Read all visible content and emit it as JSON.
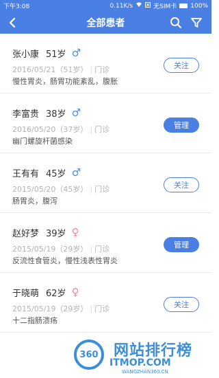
{
  "status_bar": {
    "time": "下午3:08",
    "network_speed": "0.11K/s",
    "carrier": "无SIM卡",
    "battery": "100%"
  },
  "header": {
    "title": "全部患者",
    "back_icon": "chevron-left-icon",
    "search_icon": "search-icon",
    "filter_icon": "filter-icon"
  },
  "colors": {
    "primary": "#4a7fe4",
    "male": "#4a90e2",
    "female": "#f08aa0"
  },
  "patients": [
    {
      "name": "张小康",
      "age": "51岁",
      "gender": "male",
      "gender_symbol": "♂",
      "date": "2016/05/21",
      "age_paren": "（51岁）",
      "type": "门诊",
      "diagnosis": "慢性胃炎，肠胃功能紊乱，腹胀",
      "action": "关注"
    },
    {
      "name": "李富贵",
      "age": "38岁",
      "gender": "male",
      "gender_symbol": "♂",
      "date": "2016/05/20",
      "age_paren": "（37岁）",
      "type": "门诊",
      "diagnosis": "幽门螺旋杆菌感染",
      "action": "管理"
    },
    {
      "name": "王有有",
      "age": "45岁",
      "gender": "male",
      "gender_symbol": "♂",
      "date": "2015/05/20",
      "age_paren": "（45岁）",
      "type": "门诊",
      "diagnosis": "肠胃炎，腹泻",
      "action": "关注"
    },
    {
      "name": "赵好梦",
      "age": "39岁",
      "gender": "female",
      "gender_symbol": "♀",
      "date": "2015/05/19",
      "age_paren": "（29岁）",
      "type": "门诊",
      "diagnosis": "反流性食管炎，慢性浅表性胃炎",
      "action": "管理"
    },
    {
      "name": "于晓萌",
      "age": "62岁",
      "gender": "female",
      "gender_symbol": "♀",
      "date": "2015/05/19",
      "age_paren": "（29岁）",
      "type": "门诊",
      "diagnosis": "十二指肠溃疡",
      "action": "关注"
    }
  ],
  "watermark": {
    "logo": "360",
    "text": "网站排行榜",
    "domain": "ITMOP.COM",
    "small": "WANGZHAN360.CN"
  }
}
